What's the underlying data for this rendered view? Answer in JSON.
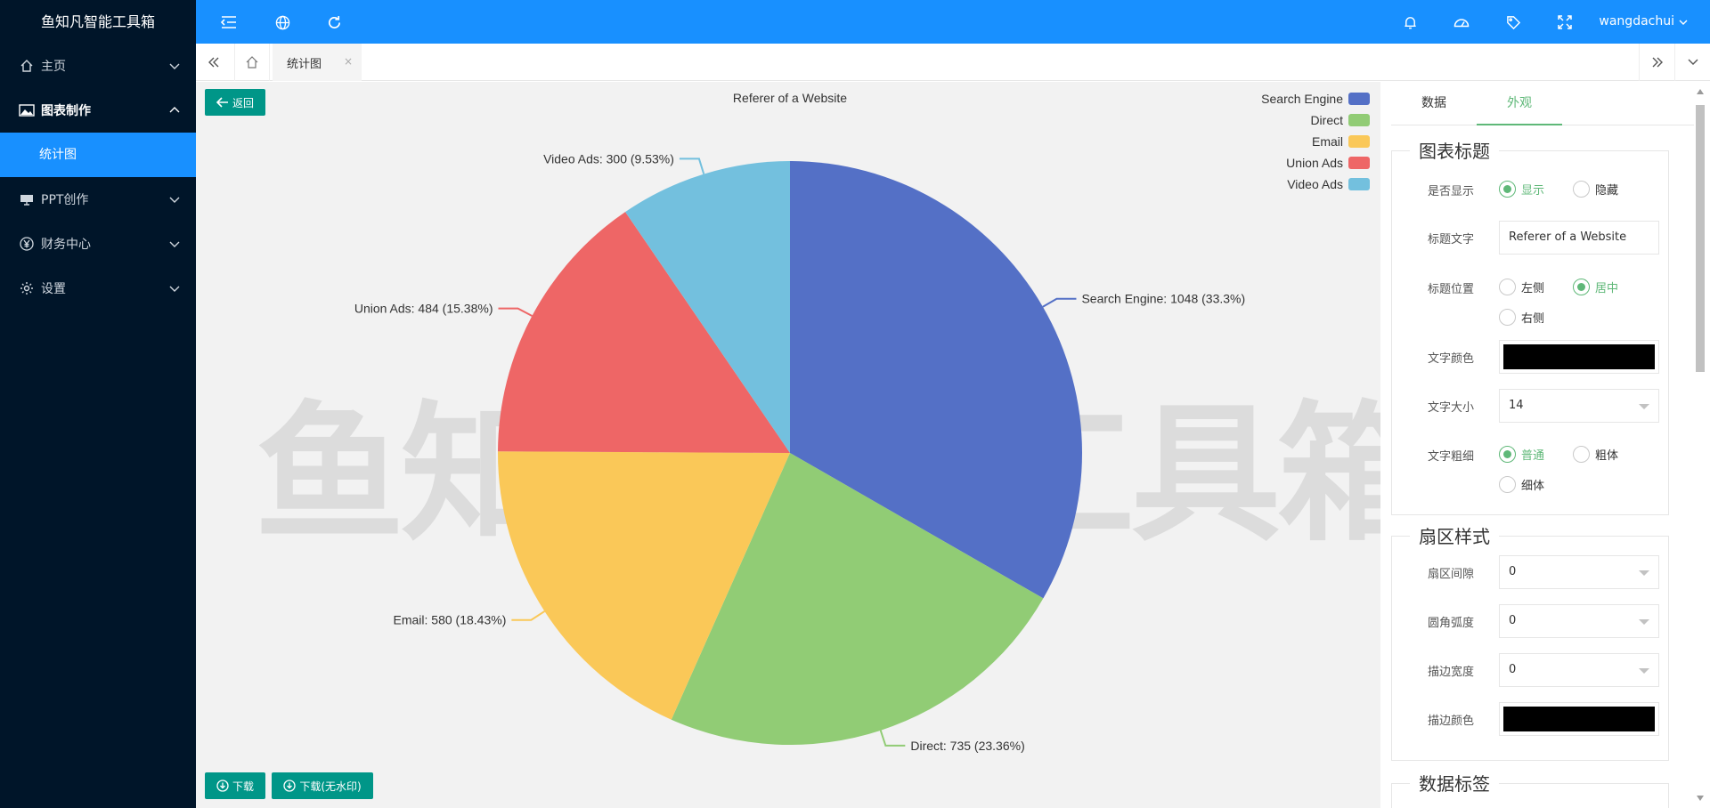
{
  "app": {
    "title": "鱼知凡智能工具箱"
  },
  "sidebar": {
    "items": [
      {
        "label": "主页",
        "icon": "home-icon"
      },
      {
        "label": "图表制作",
        "icon": "image-icon"
      },
      {
        "label": "PPT创作",
        "icon": "presentation-icon"
      },
      {
        "label": "财务中心",
        "icon": "yen-icon"
      },
      {
        "label": "设置",
        "icon": "gear-icon"
      }
    ],
    "sub_item": "统计图"
  },
  "header": {
    "user": "wangdachui"
  },
  "tabs": {
    "active": "统计图",
    "close": "×"
  },
  "chart_page": {
    "back_label": "返回",
    "download_label": "下载",
    "download_nowm_label": "下载(无水印)",
    "watermark": "鱼知凡智能工具箱"
  },
  "chart_data": {
    "type": "pie",
    "title": "Referer of a Website",
    "categories": [
      "Search Engine",
      "Direct",
      "Email",
      "Union Ads",
      "Video Ads"
    ],
    "values": [
      1048,
      735,
      580,
      484,
      300
    ],
    "labels": [
      "Search Engine: 1048 (33.3%)",
      "Direct: 735 (23.36%)",
      "Email: 580 (18.43%)",
      "Union Ads: 484 (15.38%)",
      "Video Ads: 300 (9.53%)"
    ],
    "colors": [
      "#5470c6",
      "#91cc75",
      "#fac858",
      "#ee6666",
      "#73c0de"
    ],
    "legend_position": "top-right"
  },
  "panel": {
    "tabs": [
      "数据",
      "外观"
    ],
    "active_tab": "外观",
    "title_section": {
      "legend": "图表标题",
      "show_label": "是否显示",
      "show_opt": "显示",
      "hide_opt": "隐藏",
      "text_label": "标题文字",
      "text_value": "Referer of a Website",
      "pos_label": "标题位置",
      "pos_left": "左侧",
      "pos_center": "居中",
      "pos_right": "右侧",
      "color_label": "文字颜色",
      "color_value": "#000000",
      "size_label": "文字大小",
      "size_value": "14",
      "weight_label": "文字粗细",
      "weight_normal": "普通",
      "weight_bold": "粗体",
      "weight_light": "细体"
    },
    "sector_section": {
      "legend": "扇区样式",
      "gap_label": "扇区间隙",
      "gap_value": "0",
      "radius_label": "圆角弧度",
      "radius_value": "0",
      "border_width_label": "描边宽度",
      "border_width_value": "0",
      "border_color_label": "描边颜色",
      "border_color_value": "#000000"
    },
    "label_section": {
      "legend": "数据标签"
    }
  }
}
